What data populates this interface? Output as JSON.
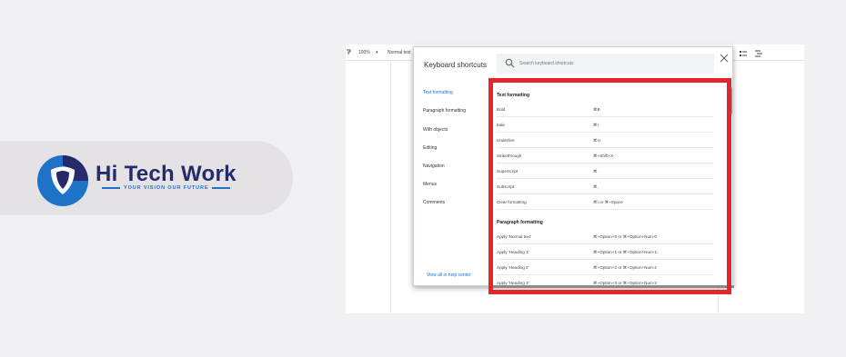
{
  "brand": {
    "name": "Hi Tech Work",
    "tagline": "YOUR VISION OUR FUTURE",
    "colors": {
      "navy": "#262a6b",
      "blue": "#1e73c8",
      "pill": "#e4e2e4"
    }
  },
  "toolbar": {
    "zoom": "100%",
    "style": "Normal text"
  },
  "dialog": {
    "title": "Keyboard shortcuts",
    "search_placeholder": "Search keyboard shortcuts",
    "nav": [
      {
        "label": "Text formatting",
        "active": true
      },
      {
        "label": "Paragraph formatting",
        "active": false
      },
      {
        "label": "With objects",
        "active": false
      },
      {
        "label": "Editing",
        "active": false
      },
      {
        "label": "Navigation",
        "active": false
      },
      {
        "label": "Menus",
        "active": false
      },
      {
        "label": "Comments",
        "active": false
      }
    ],
    "help_link": "View all in help center",
    "sections": [
      {
        "title": "Text formatting",
        "rows": [
          {
            "label": "Bold",
            "keys": "⌘B"
          },
          {
            "label": "Italic",
            "keys": "⌘I"
          },
          {
            "label": "Underline",
            "keys": "⌘U"
          },
          {
            "label": "Strikethrough",
            "keys": "⌘+Shift+X"
          },
          {
            "label": "Superscript",
            "keys": "⌘."
          },
          {
            "label": "Subscript",
            "keys": "⌘,"
          },
          {
            "label": "Clear formatting",
            "keys": "⌘\\ or ⌘+Space"
          }
        ]
      },
      {
        "title": "Paragraph formatting",
        "rows": [
          {
            "label": "Apply 'Normal text'",
            "keys": "⌘+Option+0 or ⌘+Option+Num-0"
          },
          {
            "label": "Apply 'Heading 1'",
            "keys": "⌘+Option+1 or ⌘+Option+Num-1"
          },
          {
            "label": "Apply 'Heading 2'",
            "keys": "⌘+Option+2 or ⌘+Option+Num-2"
          },
          {
            "label": "Apply 'Heading 3'",
            "keys": "⌘+Option+3 or ⌘+Option+Num-3"
          }
        ]
      }
    ]
  },
  "highlight_color": "#e3262a"
}
